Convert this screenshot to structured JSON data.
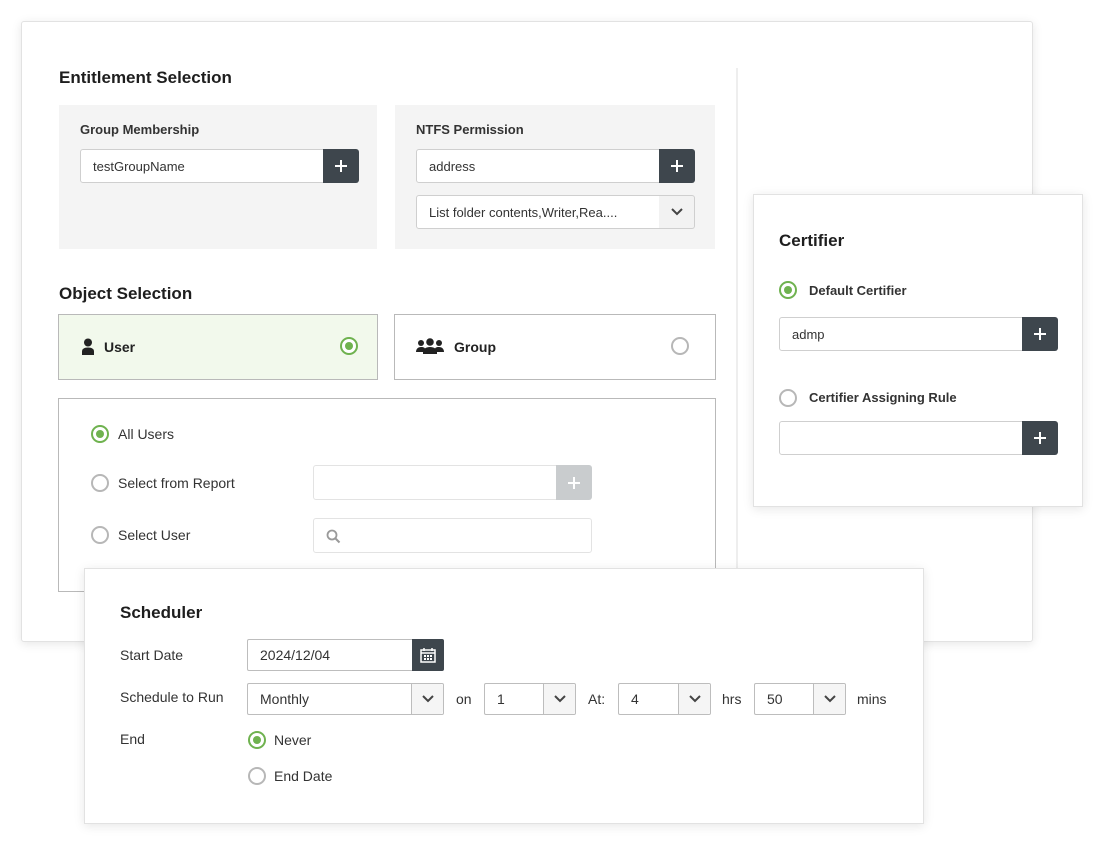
{
  "entitlement": {
    "title": "Entitlement Selection",
    "group_membership": {
      "label": "Group Membership",
      "value": "testGroupName"
    },
    "ntfs_permission": {
      "label": "NTFS Permission",
      "value": "address",
      "permissions": "List folder contents,Writer,Rea...."
    }
  },
  "object_selection": {
    "title": "Object Selection",
    "user_label": "User",
    "group_label": "Group",
    "selected": "User",
    "options": {
      "all_users": "All Users",
      "from_report": "Select from Report",
      "select_user": "Select User"
    },
    "selected_option": "All Users"
  },
  "certifier": {
    "title": "Certifier",
    "default_label": "Default Certifier",
    "default_value": "admp",
    "rule_label": "Certifier Assigning Rule",
    "rule_value": "",
    "selected": "Default Certifier"
  },
  "scheduler": {
    "title": "Scheduler",
    "start_date_label": "Start Date",
    "start_date": "2024/12/04",
    "schedule_label": "Schedule to Run",
    "frequency": "Monthly",
    "on_label": "on",
    "day": "1",
    "at_label": "At:",
    "hours": "4",
    "hrs_label": "hrs",
    "minutes": "50",
    "mins_label": "mins",
    "end_label": "End",
    "end_options": {
      "never": "Never",
      "end_date": "End Date"
    },
    "end_selected": "Never"
  },
  "colors": {
    "accent_green": "#6fb24f",
    "button_dark": "#3e464d",
    "selected_bg": "#f2f9ec"
  }
}
